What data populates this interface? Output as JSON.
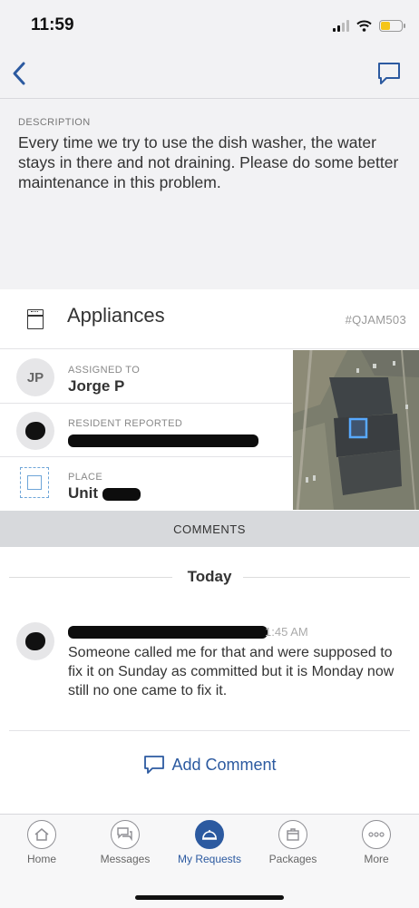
{
  "status": {
    "time": "11:59"
  },
  "description": {
    "label": "DESCRIPTION",
    "text": "Every time we try to use the dish washer, the water stays in there and not draining. Please do some better maintenance in this problem."
  },
  "category": {
    "name": "Appliances",
    "id": "#QJAM503"
  },
  "assigned": {
    "label": "ASSIGNED TO",
    "initials": "JP",
    "name": "Jorge P"
  },
  "resident": {
    "label": "RESIDENT REPORTED"
  },
  "place": {
    "label": "PLACE",
    "value": "Unit"
  },
  "comments_header": "COMMENTS",
  "today_label": "Today",
  "comment": {
    "time": "1:45 AM",
    "text": "Someone called me for that and were supposed to fix it on Sunday as committed but it is Monday now still no one came to fix it."
  },
  "add_comment": "Add Comment",
  "tabs": [
    {
      "label": "Home",
      "icon": "home-icon"
    },
    {
      "label": "Messages",
      "icon": "messages-icon"
    },
    {
      "label": "My Requests",
      "icon": "bell-icon"
    },
    {
      "label": "Packages",
      "icon": "package-icon"
    },
    {
      "label": "More",
      "icon": "more-icon"
    }
  ],
  "colors": {
    "accent": "#2c5aa0",
    "background": "#f2f2f4",
    "comments_bar": "#d7d9dc"
  }
}
